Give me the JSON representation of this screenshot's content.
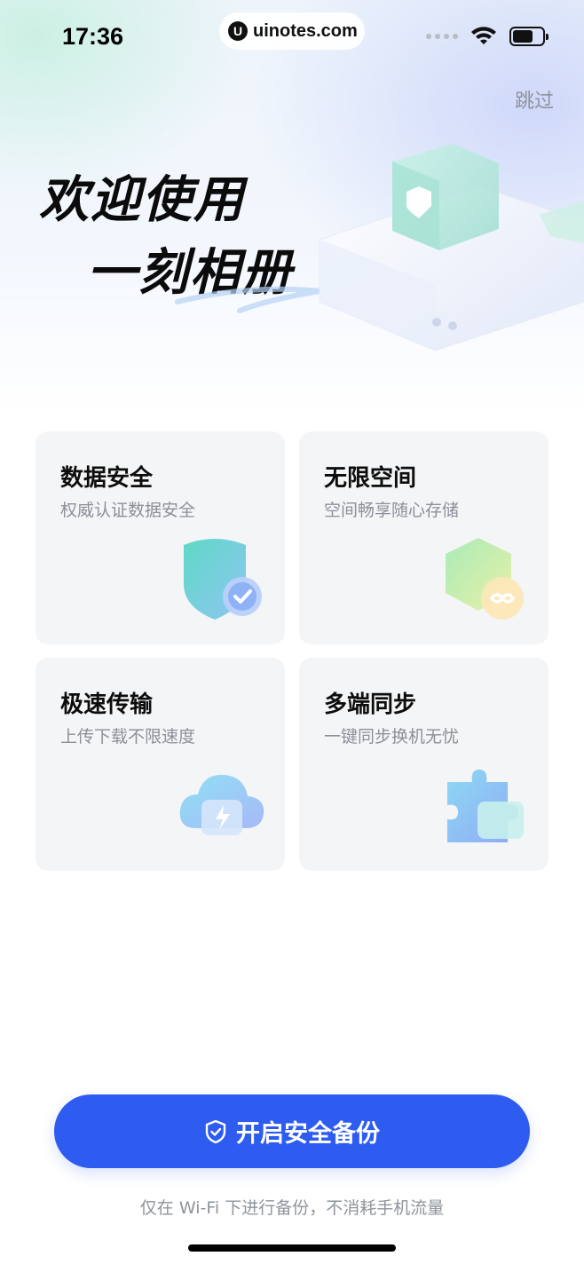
{
  "status_bar": {
    "time": "17:36",
    "watermark": "uinotes.com",
    "watermark_logo": "U",
    "icons": [
      "cellular-dots-icon",
      "wifi-icon",
      "battery-icon"
    ]
  },
  "header": {
    "skip_label": "跳过",
    "welcome_line1": "欢迎使用",
    "welcome_line2": "一刻相册"
  },
  "features": [
    {
      "title": "数据安全",
      "subtitle": "权威认证数据安全",
      "icon": "shield-check-icon"
    },
    {
      "title": "无限空间",
      "subtitle": "空间畅享随心存储",
      "icon": "infinity-cube-icon"
    },
    {
      "title": "极速传输",
      "subtitle": "上传下载不限速度",
      "icon": "cloud-bolt-icon"
    },
    {
      "title": "多端同步",
      "subtitle": "一键同步换机无忧",
      "icon": "puzzle-icon"
    }
  ],
  "primary_action": {
    "label": "开启安全备份",
    "icon": "shield-icon"
  },
  "footnote": "仅在 Wi-Fi 下进行备份，不消耗手机流量",
  "colors": {
    "accent": "#2e5cf0",
    "card_bg": "#f4f5f7",
    "subtitle": "#8b9099"
  }
}
